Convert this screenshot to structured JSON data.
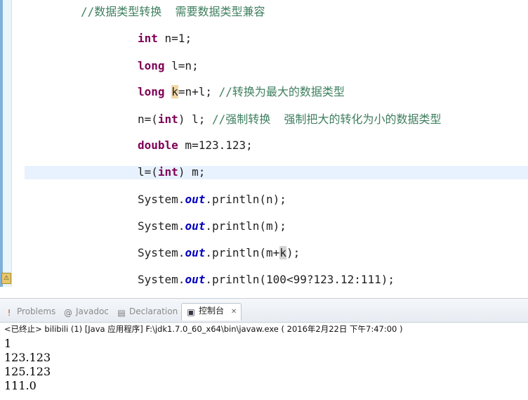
{
  "editor": {
    "lines": [
      {
        "segments": [
          {
            "text": "//数据类型转换  需要数据类型兼容",
            "cls": "cm"
          }
        ]
      },
      {
        "segments": [
          {
            "text": "int",
            "cls": "kw"
          },
          {
            "text": " n=1;",
            "cls": ""
          }
        ]
      },
      {
        "segments": [
          {
            "text": "long",
            "cls": "kw"
          },
          {
            "text": " l=n;",
            "cls": ""
          }
        ]
      },
      {
        "segments": [
          {
            "text": "long",
            "cls": "kw"
          },
          {
            "text": " ",
            "cls": ""
          },
          {
            "text": "k",
            "cls": "hl-var"
          },
          {
            "text": "=n+l; ",
            "cls": ""
          },
          {
            "text": "//转换为最大的数据类型",
            "cls": "cm"
          }
        ]
      },
      {
        "segments": [
          {
            "text": "n=(",
            "cls": ""
          },
          {
            "text": "int",
            "cls": "kw"
          },
          {
            "text": ") l; ",
            "cls": ""
          },
          {
            "text": "//强制转换  强制把大的转化为小的数据类型",
            "cls": "cm"
          }
        ]
      },
      {
        "segments": [
          {
            "text": "double",
            "cls": "kw"
          },
          {
            "text": " m=123.123;",
            "cls": ""
          }
        ]
      },
      {
        "segments": [
          {
            "text": "l=(",
            "cls": ""
          },
          {
            "text": "int",
            "cls": "kw"
          },
          {
            "text": ") m;",
            "cls": ""
          }
        ]
      },
      {
        "segments": [
          {
            "text": "System.",
            "cls": ""
          },
          {
            "text": "out",
            "cls": "fld"
          },
          {
            "text": ".println(n);",
            "cls": ""
          }
        ]
      },
      {
        "segments": [
          {
            "text": "System.",
            "cls": ""
          },
          {
            "text": "out",
            "cls": "fld"
          },
          {
            "text": ".println(m);",
            "cls": ""
          }
        ]
      },
      {
        "segments": [
          {
            "text": "System.",
            "cls": ""
          },
          {
            "text": "out",
            "cls": "fld"
          },
          {
            "text": ".println(m+",
            "cls": ""
          },
          {
            "text": "k",
            "cls": "hl-var2"
          },
          {
            "text": ");",
            "cls": ""
          }
        ]
      },
      {
        "segments": [
          {
            "text": "System.",
            "cls": ""
          },
          {
            "text": "out",
            "cls": "fld"
          },
          {
            "text": ".println(100<99?123.12:111);",
            "cls": ""
          }
        ]
      }
    ]
  },
  "tabs": {
    "problems": "Problems",
    "javadoc": "Javadoc",
    "declaration": "Declaration",
    "console": "控制台",
    "console_close": "✕"
  },
  "console": {
    "status": "<已终止> bilibili (1) [Java 应用程序] F:\\jdk1.7.0_60_x64\\bin\\javaw.exe ( 2016年2月22日 下午7:47:00 )",
    "output": [
      "1",
      "123.123",
      "125.123",
      "111.0"
    ]
  },
  "icons": {
    "problems": "problems-icon",
    "javadoc": "javadoc-icon",
    "declaration": "declaration-icon",
    "console": "console-icon"
  }
}
